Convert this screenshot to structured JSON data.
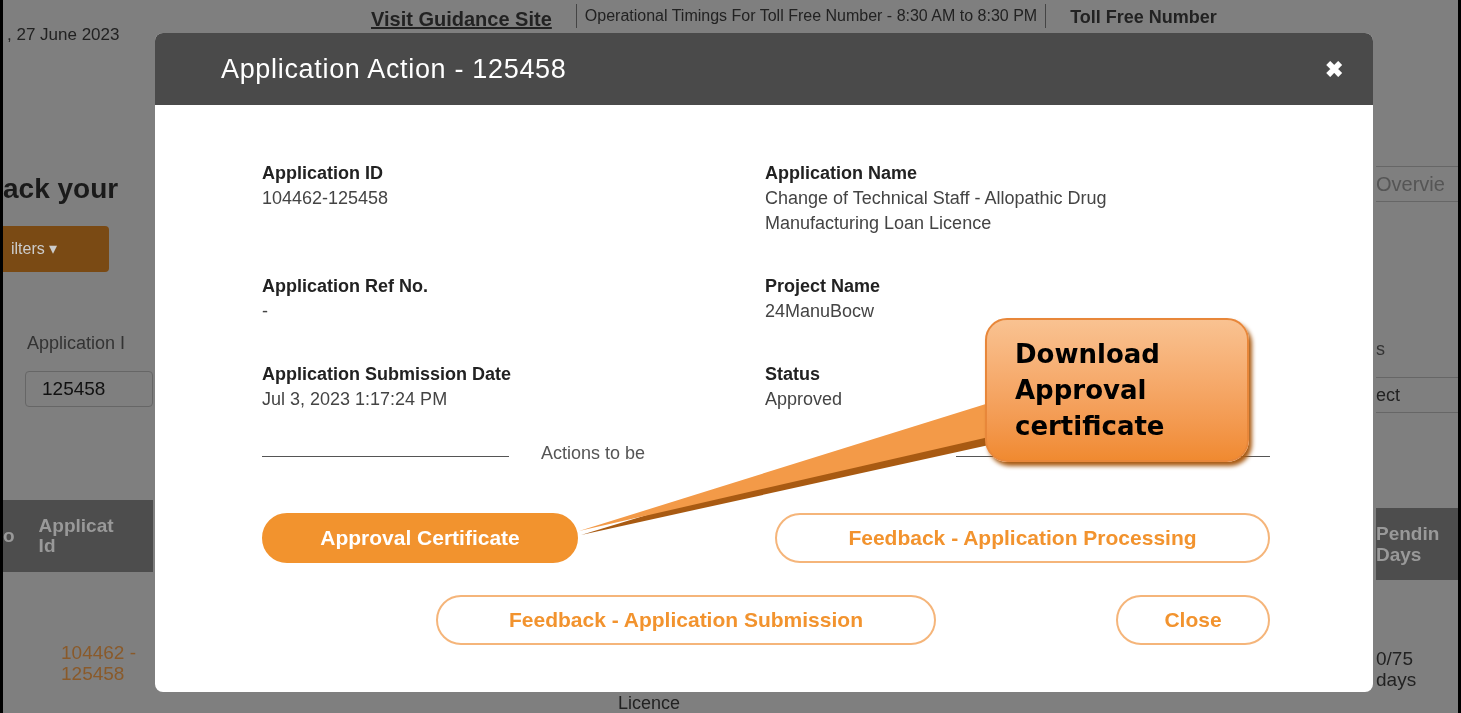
{
  "background": {
    "top_bar": {
      "date": ", 27 June 2023",
      "link": "Visit Guidance Site",
      "timings": "Operational Timings For Toll Free Number - 8:30 AM to 8:30 PM",
      "toll_free": "Toll Free Number"
    },
    "left": {
      "heading": "ack your",
      "filter_button": "ilters",
      "filter_caret": "▾",
      "field_label": "Application I",
      "field_value": "125458",
      "column_prefix": "o",
      "column_header": "Applicat Id",
      "cell": "104462 - 125458"
    },
    "right": {
      "tab": "Overvie",
      "field_label": "s",
      "select_value": "ect",
      "column_header": "Pendin Days",
      "cell": "0/75 days"
    },
    "table_fragment": "Licence"
  },
  "dialog": {
    "title": "Application Action - 125458",
    "close_glyph": "✖",
    "fields": [
      {
        "label": "Application ID",
        "value": "104462-125458"
      },
      {
        "label": "Application Name",
        "value": "Change of Technical Staff - Allopathic Drug Manufacturing Loan Licence"
      },
      {
        "label": "Application Ref No.",
        "value": "-"
      },
      {
        "label": "Project Name",
        "value": "24ManuBocw"
      },
      {
        "label": "Application Submission Date",
        "value": "Jul 3, 2023 1:17:24 PM"
      },
      {
        "label": "Status",
        "value": "Approved"
      }
    ],
    "section_label": "Actions to be",
    "button_rows": [
      [
        {
          "label": "Approval Certificate",
          "kind": "primary"
        },
        {
          "label": "Feedback - Application Processing",
          "kind": "outline"
        }
      ],
      [
        {
          "label": "Feedback - Application Submission",
          "kind": "outline"
        },
        {
          "label": "Close",
          "kind": "outline"
        }
      ]
    ]
  },
  "callout": {
    "text": "Download Approval certificate"
  }
}
